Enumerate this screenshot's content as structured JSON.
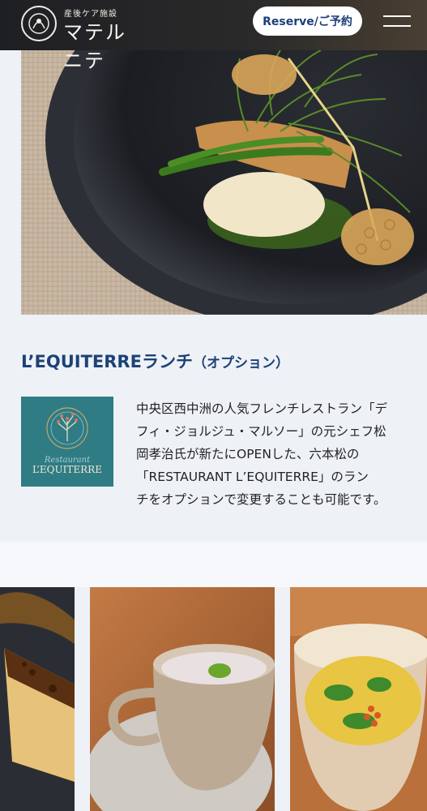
{
  "header": {
    "logo_subtitle": "産後ケア施設",
    "logo_name": "マテルニテ",
    "reserve_label": "Reserve/ご予約"
  },
  "section": {
    "title_main": "L’EQUITERREランチ",
    "title_option": "（オプション）",
    "restaurant_logo": {
      "script": "Restaurant",
      "name": "L’EQUITERRE"
    },
    "description_lines": [
      "中央区西中洲の人気フレンチレストラン「デ",
      "フィ・ジョルジュ・マルソー」の元シェフ松",
      "岡孝治氏が新たにOPENした、六本松の",
      "「RESTAURANT L’EQUITERRE」のラン",
      "チをオプションで変更することも可能です。"
    ]
  },
  "colors": {
    "header_bg": "#1e1f24",
    "accent_navy": "#1d4276",
    "logo_teal": "#2f7c85",
    "page_bg": "#eef2f7"
  }
}
